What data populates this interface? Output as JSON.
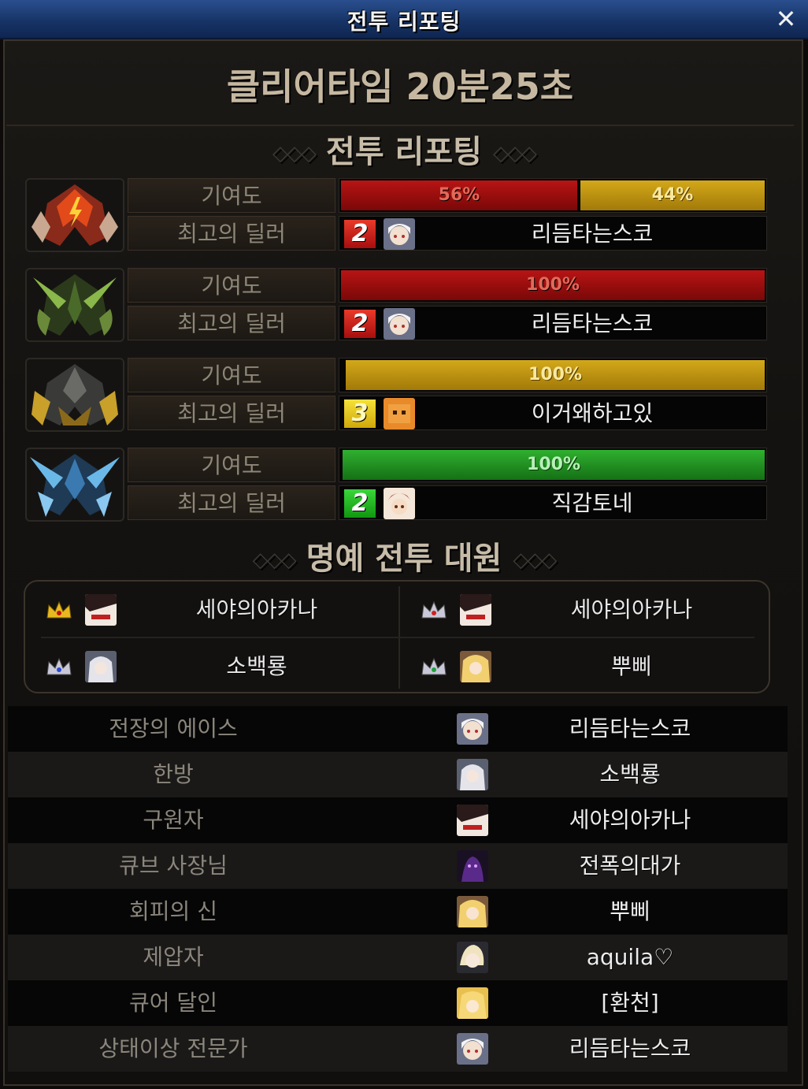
{
  "window": {
    "title": "전투 리포팅",
    "close_label": "✕"
  },
  "clear_time": "클리어타임  20분25초",
  "reporting_title": "전투 리포팅",
  "honor_title": "명예 전투 대원",
  "section_deco": "◇◇◇",
  "colors": {
    "red": "#b81414",
    "gold": "#d3a81a",
    "green": "#2fb02f",
    "blue": "#3a8fd0"
  },
  "teams": [
    {
      "emblem": "red-flame-helmet-icon",
      "contribution_label": "기여도",
      "bars": [
        {
          "color": "red",
          "value": 56,
          "label": "56%"
        },
        {
          "color": "gold",
          "value": 44,
          "label": "44%"
        }
      ],
      "best_dealer_label": "최고의 딜러",
      "best_dealer": {
        "rank": "2",
        "rank_color": "red",
        "avatar": "white-hair-girl-avatar",
        "name": "리듬타는스코"
      }
    },
    {
      "emblem": "green-leaf-helmet-icon",
      "contribution_label": "기여도",
      "bars": [
        {
          "color": "red",
          "value": 100,
          "label": "100%"
        }
      ],
      "best_dealer_label": "최고의 딜러",
      "best_dealer": {
        "rank": "2",
        "rank_color": "red",
        "avatar": "white-hair-girl-avatar",
        "name": "리듬타는스코"
      }
    },
    {
      "emblem": "gold-dark-helmet-icon",
      "contribution_label": "기여도",
      "bars": [
        {
          "color": "gold",
          "value": 100,
          "label": "100%"
        }
      ],
      "best_dealer_label": "최고의 딜러",
      "best_dealer": {
        "rank": "3",
        "rank_color": "yellow",
        "avatar": "orange-cube-avatar",
        "name": "이거왜하고있"
      }
    },
    {
      "emblem": "blue-ice-helmet-icon",
      "contribution_label": "기여도",
      "bars": [
        {
          "color": "green",
          "value": 100,
          "label": "100%"
        }
      ],
      "best_dealer_label": "최고의 딜러",
      "best_dealer": {
        "rank": "2",
        "rank_color": "green",
        "avatar": "brown-hair-avatar",
        "name": "직감토네"
      }
    }
  ],
  "honor_members": [
    {
      "crown": "gold-crown-icon",
      "avatar": "dark-hair-avatar",
      "name": "세야의아카나"
    },
    {
      "crown": "red-crown-icon",
      "avatar": "dark-hair-avatar",
      "name": "세야의아카나"
    },
    {
      "crown": "blue-crown-icon",
      "avatar": "silver-hair-avatar",
      "name": "소백룡"
    },
    {
      "crown": "green-crown-icon",
      "avatar": "blonde-avatar",
      "name": "뿌삐"
    }
  ],
  "awards": [
    {
      "title": "전장의 에이스",
      "avatar": "white-hair-girl-avatar",
      "player": "리듬타는스코"
    },
    {
      "title": "한방",
      "avatar": "silver-hair-avatar",
      "player": "소백룡"
    },
    {
      "title": "구원자",
      "avatar": "dark-hair-avatar",
      "player": "세야의아카나"
    },
    {
      "title": "큐브 사장님",
      "avatar": "purple-shadow-avatar",
      "player": "전폭의대가"
    },
    {
      "title": "회피의 신",
      "avatar": "blonde-avatar",
      "player": "뿌삐"
    },
    {
      "title": "제압자",
      "avatar": "light-hair-avatar",
      "player": "aquila♡"
    },
    {
      "title": "큐어 달인",
      "avatar": "golden-hair-avatar",
      "player": "[환천]"
    },
    {
      "title": "상태이상 전문가",
      "avatar": "white-hair-girl-avatar",
      "player": "리듬타는스코"
    }
  ]
}
